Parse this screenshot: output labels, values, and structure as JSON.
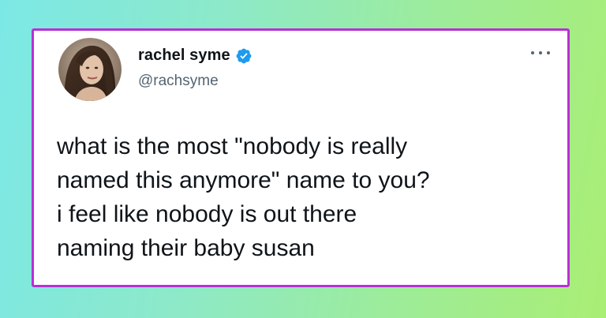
{
  "tweet": {
    "display_name": "rachel syme",
    "handle": "@rachsyme",
    "lines": [
      "what is the most \"nobody is really",
      "named this anymore\" name to you?",
      "i feel like nobody is out there",
      "naming their baby susan"
    ],
    "verified_icon": "verified-badge-icon",
    "more_icon": "more-horizontal-icon"
  },
  "colors": {
    "card_border": "#b92fd6",
    "verified_blue": "#1d9bf0",
    "text_primary": "#0f1419",
    "text_secondary": "#536471"
  }
}
